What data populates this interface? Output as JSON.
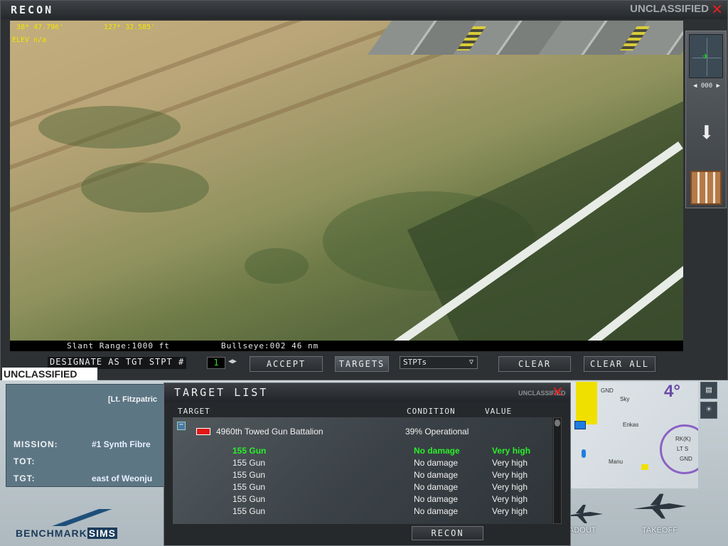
{
  "recon": {
    "title": "RECON",
    "watermark_top": "UNCLASSIFIED",
    "watermark_bottom": "UNCLASSIFIED",
    "hud": {
      "lat": "38* 47.796'",
      "lon": "127* 32.585'",
      "elev": "ELEV n/a"
    },
    "status": {
      "slant_range": "Slant Range:1000 ft",
      "bullseye": "Bullseye:002  46 nm"
    },
    "heading": "◀ 000 ▶",
    "controls": {
      "designate_label": "DESIGNATE AS TGT STPT #",
      "stpt_number": "1",
      "accept": "ACCEPT",
      "targets": "TARGETS",
      "stpts": "STPTs",
      "clear": "CLEAR",
      "clear_all": "CLEAR ALL"
    }
  },
  "target_list": {
    "title": "TARGET LIST",
    "watermark": "UNCLASSIFIED",
    "columns": {
      "target": "TARGET",
      "condition": "CONDITION",
      "value": "VALUE"
    },
    "unit": {
      "name": "4960th Towed Gun Battalion",
      "condition": "39% Operational"
    },
    "rows": [
      {
        "name": "155 Gun",
        "condition": "No damage",
        "value": "Very high"
      },
      {
        "name": "155 Gun",
        "condition": "No damage",
        "value": "Very high"
      },
      {
        "name": "155 Gun",
        "condition": "No damage",
        "value": "Very high"
      },
      {
        "name": "155 Gun",
        "condition": "No damage",
        "value": "Very high"
      },
      {
        "name": "155 Gun",
        "condition": "No damage",
        "value": "Very high"
      },
      {
        "name": "155 Gun",
        "condition": "No damage",
        "value": "Very high"
      }
    ],
    "recon_button": "RECON"
  },
  "background": {
    "pilot": "[Lt. Fitzpatric",
    "mission_label": "MISSION:",
    "mission_value": "#1 Synth Fibre",
    "tot_label": "TOT:",
    "tgt_label": "TGT:",
    "tgt_value": "east of Weonju",
    "logo_a": "BENCHMARK",
    "logo_b": "SIMS",
    "loadout": "ADOUT",
    "takeoff": "TAKEOFF",
    "map_labels": {
      "gnd1": "GND",
      "sky": "Sky",
      "enkas": "Enkas",
      "manu": "Manu",
      "rk": "RK(K)",
      "it": "LT S",
      "gnd2": "GND",
      "four": "4°"
    }
  },
  "colors": {
    "hud_yellow": "#f4e400",
    "selected_row": "#2bef2b",
    "close_red": "#e41e1e"
  }
}
